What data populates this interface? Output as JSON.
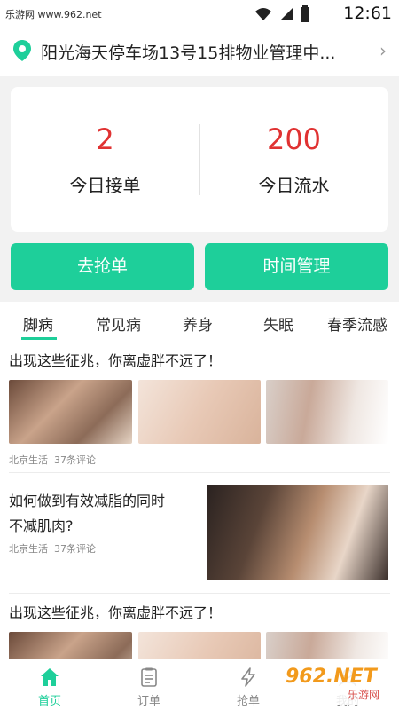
{
  "status_bar": {
    "watermark": "乐游网 www.962.net",
    "time": "12:61",
    "icons": [
      "wifi-icon",
      "signal-icon",
      "battery-icon"
    ]
  },
  "location": {
    "address": "阳光海天停车场13号15排物业管理中...",
    "icon": "location-pin-icon",
    "chevron": "›"
  },
  "stats": [
    {
      "value": "2",
      "label": "今日接单"
    },
    {
      "value": "200",
      "label": "今日流水"
    }
  ],
  "actions": {
    "grab_label": "去抢单",
    "time_label": "时间管理"
  },
  "category_tabs": [
    "脚病",
    "常见病",
    "养身",
    "失眠",
    "春季流感"
  ],
  "articles": [
    {
      "title": "出现这些征兆，你离虚胖不远了！",
      "source": "北京生活",
      "comments": "37条评论"
    },
    {
      "title_line1": "如何做到有效减脂的同时",
      "title_line2": "不减肌肉?",
      "source": "北京生活",
      "comments": "37条评论"
    },
    {
      "title": "出现这些征兆，你离虚胖不远了！"
    }
  ],
  "tabbar": [
    {
      "label": "首页",
      "icon": "home-icon",
      "active": true
    },
    {
      "label": "订单",
      "icon": "clipboard-icon",
      "active": false
    },
    {
      "label": "抢单",
      "icon": "lightning-icon",
      "active": false
    },
    {
      "label": "我的",
      "icon": "person-icon",
      "active": false
    }
  ],
  "watermark_bottom": {
    "brand": "962.NET",
    "sub": "乐游网"
  },
  "colors": {
    "accent": "#1ecf9a",
    "number_red": "#e03232"
  }
}
